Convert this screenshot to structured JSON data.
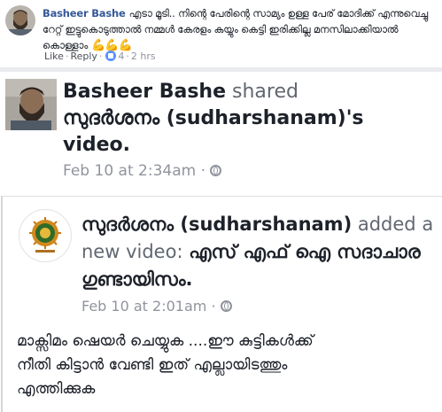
{
  "comment": {
    "author": "Basheer Bashe",
    "text": "എടാ മൂടി.. നിന്റെ പേരിന്റെ സാമ്യം ഉള്ള പേര് മോദിക്ക് എന്നുവെച്ചു റേറ്റ് ഇട്ടുകൊടുത്താൽ നമ്മൾ കേരളം കയ്യും കെട്ടി ഇരിക്കില്ല മനസിലാക്കിയാൽ കൊള്ളാം",
    "emoji": "💪💪💪",
    "actions": {
      "like": "Like",
      "reply": "Reply",
      "reaction_count": "4",
      "time": "2 hrs"
    }
  },
  "shared_post": {
    "author": "Basheer Bashe",
    "verb": "shared",
    "source_page": "സുദർശനം (sudharshanam)'s",
    "object": "video.",
    "time": "Feb 10 at 2:34am",
    "privacy_icon": "globe-icon"
  },
  "inner_post": {
    "page_name": "സുദർശനം (sudharshanam)",
    "verb": "added a new video:",
    "video_title": "എസ് എഫ് ഐ സദാചാര ഗുണ്ടായിസം.",
    "time": "Feb 10 at 2:01am",
    "privacy_icon": "globe-icon",
    "body_lines": [
      "മാക്സിമം ഷെയർ ചെയ്യുക ....ഈ  കുട്ടികൾക്ക്",
      "നീതി കിട്ടാൻ വേണ്ടി ഇത് എല്ലായിടത്തും",
      "എത്തിക്കുക"
    ]
  },
  "colors": {
    "link_blue": "#365899",
    "meta_gray": "#90949c",
    "separator": "#e9ebee",
    "like_blue": "#5890ff"
  }
}
